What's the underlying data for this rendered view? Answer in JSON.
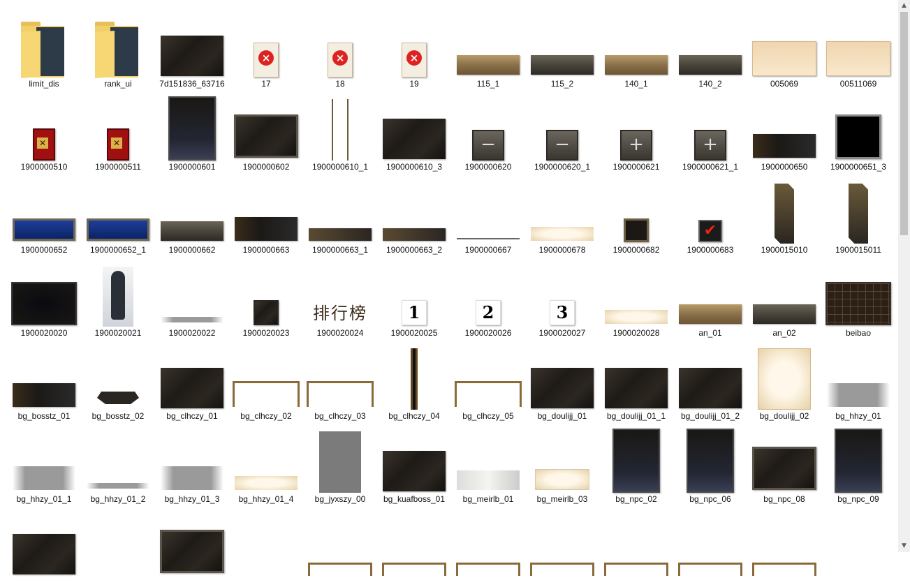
{
  "files": [
    {
      "name": "limit_dis",
      "thumb": "folder"
    },
    {
      "name": "rank_ui",
      "thumb": "folder"
    },
    {
      "name": "7d151836_63716",
      "thumb": "dark-panel"
    },
    {
      "name": "17",
      "thumb": "x-scroll"
    },
    {
      "name": "18",
      "thumb": "x-scroll"
    },
    {
      "name": "19",
      "thumb": "x-scroll"
    },
    {
      "name": "115_1",
      "thumb": "gold-bar"
    },
    {
      "name": "115_2",
      "thumb": "stone-bar"
    },
    {
      "name": "140_1",
      "thumb": "gold-bar"
    },
    {
      "name": "140_2",
      "thumb": "stone-bar"
    },
    {
      "name": "005069",
      "thumb": "parchment"
    },
    {
      "name": "00511069",
      "thumb": "parchment"
    },
    {
      "name": "1900000510",
      "thumb": "red-card"
    },
    {
      "name": "1900000511",
      "thumb": "red-card"
    },
    {
      "name": "1900000601",
      "thumb": "tall-panel"
    },
    {
      "name": "1900000602",
      "thumb": "frame-panel"
    },
    {
      "name": "1900000610_1",
      "thumb": "dragon-strip"
    },
    {
      "name": "1900000610_3",
      "thumb": "dark-panel"
    },
    {
      "name": "1900000620",
      "thumb": "minus-button"
    },
    {
      "name": "1900000620_1",
      "thumb": "minus-button"
    },
    {
      "name": "1900000621",
      "thumb": "plus-button"
    },
    {
      "name": "1900000621_1",
      "thumb": "plus-button"
    },
    {
      "name": "1900000650",
      "thumb": "dark-bar"
    },
    {
      "name": "1900000651_3",
      "thumb": "black-frame"
    },
    {
      "name": "1900000652",
      "thumb": "blue-bar"
    },
    {
      "name": "1900000652_1",
      "thumb": "blue-bar"
    },
    {
      "name": "1900000662",
      "thumb": "stone-bar"
    },
    {
      "name": "1900000663",
      "thumb": "dark-bar"
    },
    {
      "name": "1900000663_1",
      "thumb": "thin-bar"
    },
    {
      "name": "1900000663_2",
      "thumb": "thin-bar"
    },
    {
      "name": "1900000667",
      "thumb": "line"
    },
    {
      "name": "1900000678",
      "thumb": "cream-strip"
    },
    {
      "name": "1900000682",
      "thumb": "square-frame"
    },
    {
      "name": "1900000683",
      "thumb": "checkbox"
    },
    {
      "name": "1900015010",
      "thumb": "slanted-tab"
    },
    {
      "name": "1900015011",
      "thumb": "slanted-tab"
    },
    {
      "name": "1900020020",
      "thumb": "black-panel"
    },
    {
      "name": "1900020021",
      "thumb": "ink-figure"
    },
    {
      "name": "1900020022",
      "thumb": "gray-strip"
    },
    {
      "name": "1900020023",
      "thumb": "small-square"
    },
    {
      "name": "1900020024",
      "thumb": "hanzi-title",
      "text": "排行榜"
    },
    {
      "name": "1900020025",
      "thumb": "number",
      "text": "1"
    },
    {
      "name": "1900020026",
      "thumb": "number",
      "text": "2"
    },
    {
      "name": "1900020027",
      "thumb": "number",
      "text": "3"
    },
    {
      "name": "1900020028",
      "thumb": "cream-strip"
    },
    {
      "name": "an_01",
      "thumb": "gold-bar"
    },
    {
      "name": "an_02",
      "thumb": "stone-bar"
    },
    {
      "name": "beibao",
      "thumb": "grid-panel"
    },
    {
      "name": "bg_bosstz_01",
      "thumb": "dark-bar"
    },
    {
      "name": "bg_bosstz_02",
      "thumb": "trapezoid"
    },
    {
      "name": "bg_clhczy_01",
      "thumb": "dark-panel"
    },
    {
      "name": "bg_clhczy_02",
      "thumb": "frame-lines"
    },
    {
      "name": "bg_clhczy_03",
      "thumb": "frame-lines"
    },
    {
      "name": "bg_clhczy_04",
      "thumb": "vertical-bars"
    },
    {
      "name": "bg_clhczy_05",
      "thumb": "frame-lines"
    },
    {
      "name": "bg_doulijj_01",
      "thumb": "dark-panel"
    },
    {
      "name": "bg_doulijj_01_1",
      "thumb": "dark-panel"
    },
    {
      "name": "bg_doulijj_01_2",
      "thumb": "dark-panel"
    },
    {
      "name": "bg_doulijj_02",
      "thumb": "cream-panel"
    },
    {
      "name": "bg_hhzy_01",
      "thumb": "gray-fade"
    },
    {
      "name": "bg_hhzy_01_1",
      "thumb": "gray-fade"
    },
    {
      "name": "bg_hhzy_01_2",
      "thumb": "gray-strip"
    },
    {
      "name": "bg_hhzy_01_3",
      "thumb": "gray-fade"
    },
    {
      "name": "bg_hhzy_01_4",
      "thumb": "cream-strip"
    },
    {
      "name": "bg_jyxszy_00",
      "thumb": "gray-block"
    },
    {
      "name": "bg_kuafboss_01",
      "thumb": "dark-panel"
    },
    {
      "name": "bg_meirlb_01",
      "thumb": "silver-bar"
    },
    {
      "name": "bg_meirlb_03",
      "thumb": "cream-bar"
    },
    {
      "name": "bg_npc_02",
      "thumb": "tall-panel"
    },
    {
      "name": "bg_npc_06",
      "thumb": "tall-panel"
    },
    {
      "name": "bg_npc_08",
      "thumb": "frame-panel"
    },
    {
      "name": "bg_npc_09",
      "thumb": "tall-panel"
    },
    {
      "name": "",
      "thumb": "dark-panel"
    },
    {
      "name": "",
      "thumb": "blank"
    },
    {
      "name": "",
      "thumb": "frame-panel"
    },
    {
      "name": "",
      "thumb": "blank"
    },
    {
      "name": "",
      "thumb": "frame-top"
    },
    {
      "name": "",
      "thumb": "frame-top"
    },
    {
      "name": "",
      "thumb": "frame-top"
    },
    {
      "name": "",
      "thumb": "frame-top"
    },
    {
      "name": "",
      "thumb": "frame-top"
    },
    {
      "name": "",
      "thumb": "frame-top"
    },
    {
      "name": "",
      "thumb": "frame-top"
    },
    {
      "name": "",
      "thumb": "blank"
    }
  ]
}
